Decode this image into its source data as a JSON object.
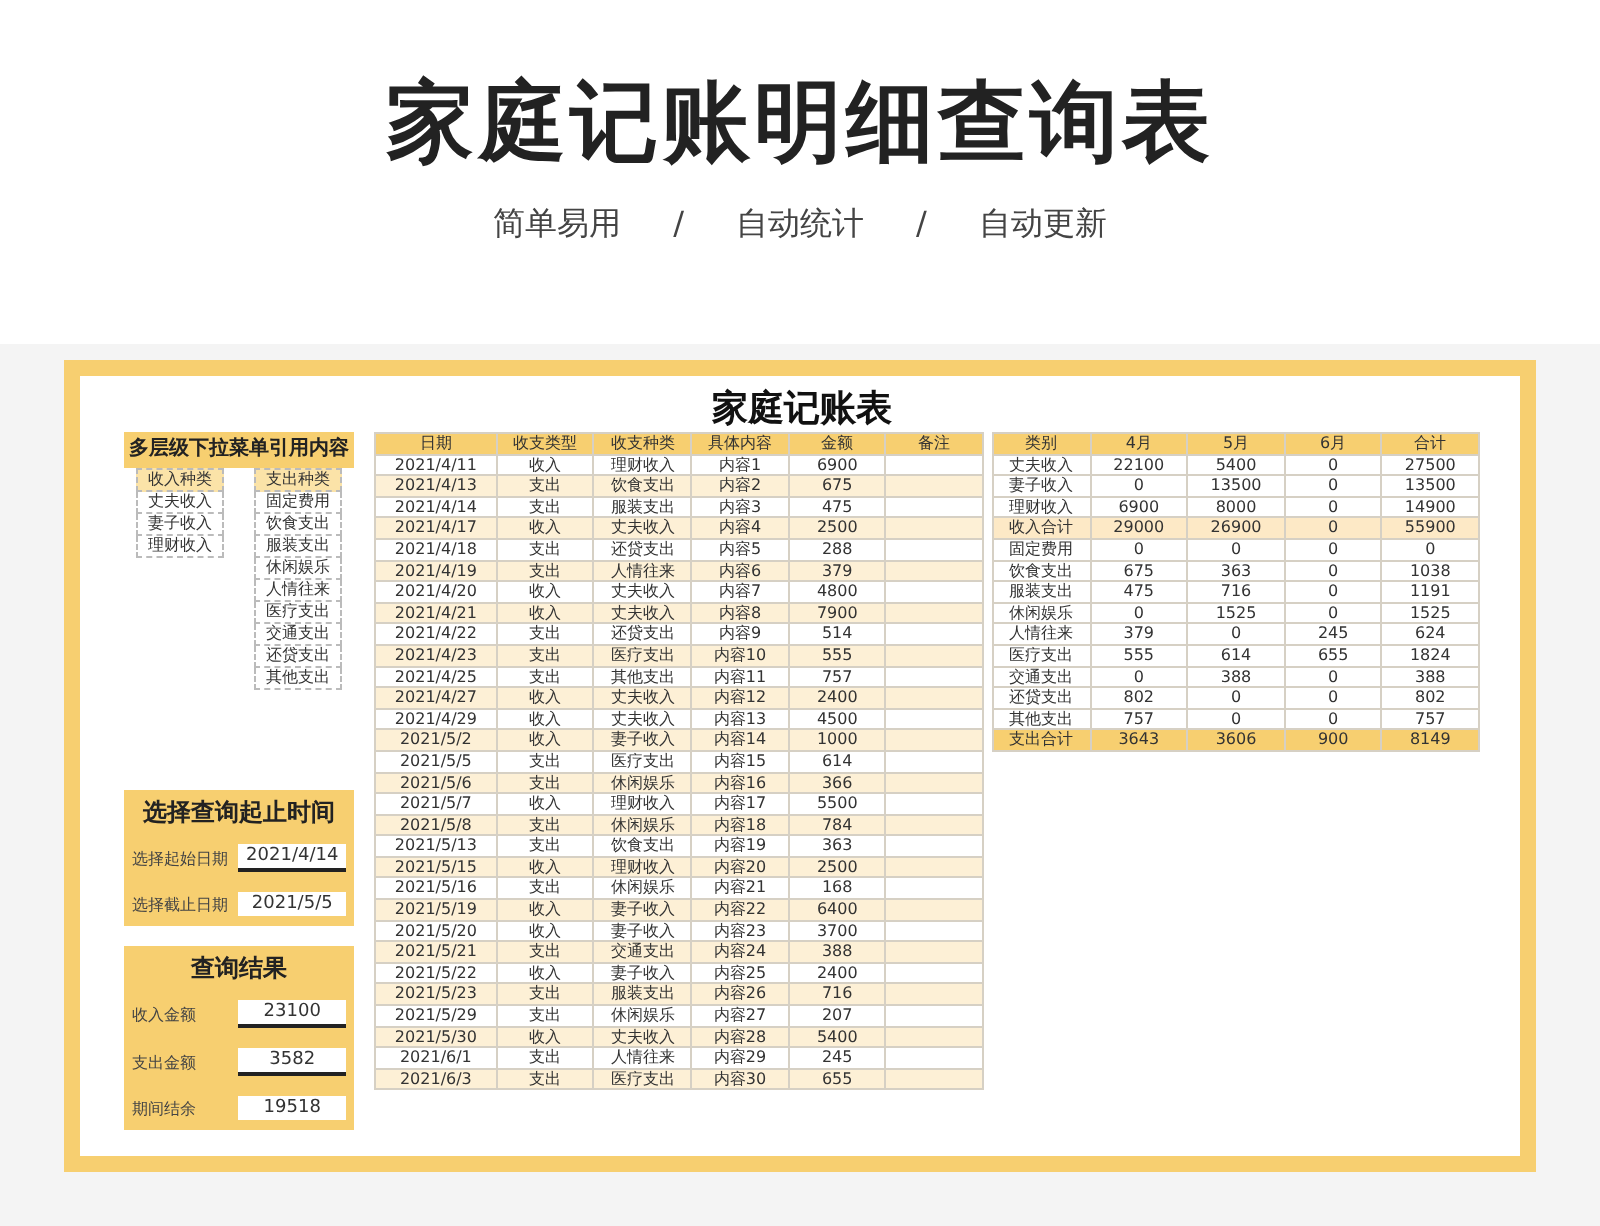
{
  "title": "家庭记账明细查询表",
  "subtitle": [
    "简单易用",
    "/",
    "自动统计",
    "/",
    "自动更新"
  ],
  "sheet": {
    "title": "家庭记账表",
    "dropdown_ref": {
      "title": "多层级下拉菜单引用内容",
      "lists": [
        {
          "header": "收入种类",
          "items": [
            "丈夫收入",
            "妻子收入",
            "理财收入"
          ]
        },
        {
          "header": "支出种类",
          "items": [
            "固定费用",
            "饮食支出",
            "服装支出",
            "休闲娱乐",
            "人情往来",
            "医疗支出",
            "交通支出",
            "还贷支出",
            "其他支出"
          ]
        }
      ]
    },
    "date_range": {
      "title": "选择查询起止时间",
      "fields": [
        {
          "label": "选择起始日期",
          "value": "2021/4/14"
        },
        {
          "label": "选择截止日期",
          "value": "2021/5/5"
        }
      ]
    },
    "results": {
      "title": "查询结果",
      "fields": [
        {
          "label": "收入金额",
          "value": "23100"
        },
        {
          "label": "支出金额",
          "value": "3582"
        },
        {
          "label": "期间结余",
          "value": "19518"
        }
      ]
    },
    "ledger": {
      "columns": [
        "日期",
        "收支类型",
        "收支种类",
        "具体内容",
        "金额",
        "备注"
      ],
      "rows": [
        [
          "2021/4/11",
          "收入",
          "理财收入",
          "内容1",
          "6900"
        ],
        [
          "2021/4/13",
          "支出",
          "饮食支出",
          "内容2",
          "675"
        ],
        [
          "2021/4/14",
          "支出",
          "服装支出",
          "内容3",
          "475"
        ],
        [
          "2021/4/17",
          "收入",
          "丈夫收入",
          "内容4",
          "2500"
        ],
        [
          "2021/4/18",
          "支出",
          "还贷支出",
          "内容5",
          "288"
        ],
        [
          "2021/4/19",
          "支出",
          "人情往来",
          "内容6",
          "379"
        ],
        [
          "2021/4/20",
          "收入",
          "丈夫收入",
          "内容7",
          "4800"
        ],
        [
          "2021/4/21",
          "收入",
          "丈夫收入",
          "内容8",
          "7900"
        ],
        [
          "2021/4/22",
          "支出",
          "还贷支出",
          "内容9",
          "514"
        ],
        [
          "2021/4/23",
          "支出",
          "医疗支出",
          "内容10",
          "555"
        ],
        [
          "2021/4/25",
          "支出",
          "其他支出",
          "内容11",
          "757"
        ],
        [
          "2021/4/27",
          "收入",
          "丈夫收入",
          "内容12",
          "2400"
        ],
        [
          "2021/4/29",
          "收入",
          "丈夫收入",
          "内容13",
          "4500"
        ],
        [
          "2021/5/2",
          "收入",
          "妻子收入",
          "内容14",
          "1000"
        ],
        [
          "2021/5/5",
          "支出",
          "医疗支出",
          "内容15",
          "614"
        ],
        [
          "2021/5/6",
          "支出",
          "休闲娱乐",
          "内容16",
          "366"
        ],
        [
          "2021/5/7",
          "收入",
          "理财收入",
          "内容17",
          "5500"
        ],
        [
          "2021/5/8",
          "支出",
          "休闲娱乐",
          "内容18",
          "784"
        ],
        [
          "2021/5/13",
          "支出",
          "饮食支出",
          "内容19",
          "363"
        ],
        [
          "2021/5/15",
          "收入",
          "理财收入",
          "内容20",
          "2500"
        ],
        [
          "2021/5/16",
          "支出",
          "休闲娱乐",
          "内容21",
          "168"
        ],
        [
          "2021/5/19",
          "收入",
          "妻子收入",
          "内容22",
          "6400"
        ],
        [
          "2021/5/20",
          "收入",
          "妻子收入",
          "内容23",
          "3700"
        ],
        [
          "2021/5/21",
          "支出",
          "交通支出",
          "内容24",
          "388"
        ],
        [
          "2021/5/22",
          "收入",
          "妻子收入",
          "内容25",
          "2400"
        ],
        [
          "2021/5/23",
          "支出",
          "服装支出",
          "内容26",
          "716"
        ],
        [
          "2021/5/29",
          "支出",
          "休闲娱乐",
          "内容27",
          "207"
        ],
        [
          "2021/5/30",
          "收入",
          "丈夫收入",
          "内容28",
          "5400"
        ],
        [
          "2021/6/1",
          "支出",
          "人情往来",
          "内容29",
          "245"
        ],
        [
          "2021/6/3",
          "支出",
          "医疗支出",
          "内容30",
          "655"
        ]
      ]
    },
    "summary": {
      "columns": [
        "类别",
        "4月",
        "5月",
        "6月",
        "合计"
      ],
      "rows": [
        {
          "kind": "item",
          "cells": [
            "丈夫收入",
            "22100",
            "5400",
            "0",
            "27500"
          ]
        },
        {
          "kind": "item",
          "cells": [
            "妻子收入",
            "0",
            "13500",
            "0",
            "13500"
          ]
        },
        {
          "kind": "item",
          "cells": [
            "理财收入",
            "6900",
            "8000",
            "0",
            "14900"
          ]
        },
        {
          "kind": "subtotal",
          "cells": [
            "收入合计",
            "29000",
            "26900",
            "0",
            "55900"
          ]
        },
        {
          "kind": "item",
          "cells": [
            "固定费用",
            "0",
            "0",
            "0",
            "0"
          ]
        },
        {
          "kind": "item",
          "cells": [
            "饮食支出",
            "675",
            "363",
            "0",
            "1038"
          ]
        },
        {
          "kind": "item",
          "cells": [
            "服装支出",
            "475",
            "716",
            "0",
            "1191"
          ]
        },
        {
          "kind": "item",
          "cells": [
            "休闲娱乐",
            "0",
            "1525",
            "0",
            "1525"
          ]
        },
        {
          "kind": "item",
          "cells": [
            "人情往来",
            "379",
            "0",
            "245",
            "624"
          ]
        },
        {
          "kind": "item",
          "cells": [
            "医疗支出",
            "555",
            "614",
            "655",
            "1824"
          ]
        },
        {
          "kind": "item",
          "cells": [
            "交通支出",
            "0",
            "388",
            "0",
            "388"
          ]
        },
        {
          "kind": "item",
          "cells": [
            "还贷支出",
            "802",
            "0",
            "0",
            "802"
          ]
        },
        {
          "kind": "item",
          "cells": [
            "其他支出",
            "757",
            "0",
            "0",
            "757"
          ]
        },
        {
          "kind": "total",
          "cells": [
            "支出合计",
            "3643",
            "3606",
            "900",
            "8149"
          ]
        }
      ]
    }
  }
}
